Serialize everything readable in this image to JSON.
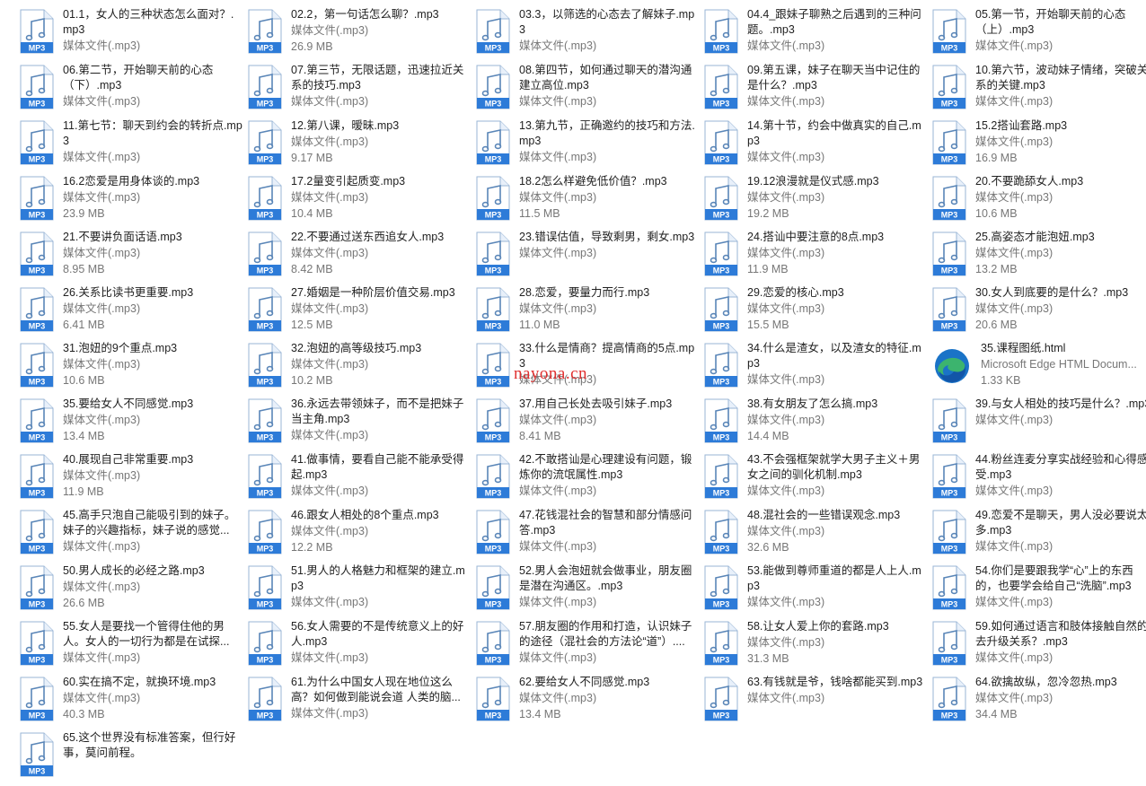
{
  "watermark": "nayona.cn",
  "icons": {
    "audio": "mp3-music-file-icon",
    "html": "microsoft-edge-icon"
  },
  "colors": {
    "mp3_badge": "#2d7bd8",
    "edge_blue": "#1a73c7",
    "edge_green": "#3cb46e"
  },
  "files": [
    {
      "name": "01.1，女人的三种状态怎么面对？.mp3",
      "type": "媒体文件(.mp3)",
      "size": "",
      "icon": "audio"
    },
    {
      "name": "02.2，第一句话怎么聊？.mp3",
      "type": "媒体文件(.mp3)",
      "size": "26.9 MB",
      "icon": "audio"
    },
    {
      "name": "03.3，以筛选的心态去了解妹子.mp3",
      "type": "媒体文件(.mp3)",
      "size": "",
      "icon": "audio"
    },
    {
      "name": "04.4_跟妹子聊熟之后遇到的三种问题。.mp3",
      "type": "媒体文件(.mp3)",
      "size": "",
      "icon": "audio"
    },
    {
      "name": "05.第一节，开始聊天前的心态（上）.mp3",
      "type": "媒体文件(.mp3)",
      "size": "",
      "icon": "audio"
    },
    {
      "name": "06.第二节，开始聊天前的心态（下）.mp3",
      "type": "媒体文件(.mp3)",
      "size": "",
      "icon": "audio"
    },
    {
      "name": "07.第三节，无限话题，迅速拉近关系的技巧.mp3",
      "type": "媒体文件(.mp3)",
      "size": "",
      "icon": "audio"
    },
    {
      "name": "08.第四节，如何通过聊天的潜沟通建立高位.mp3",
      "type": "媒体文件(.mp3)",
      "size": "",
      "icon": "audio"
    },
    {
      "name": "09.第五课，妹子在聊天当中记住的是什么？.mp3",
      "type": "媒体文件(.mp3)",
      "size": "",
      "icon": "audio"
    },
    {
      "name": "10.第六节，波动妹子情绪，突破关系的关键.mp3",
      "type": "媒体文件(.mp3)",
      "size": "",
      "icon": "audio"
    },
    {
      "name": "11.第七节：聊天到约会的转折点.mp3",
      "type": "媒体文件(.mp3)",
      "size": "",
      "icon": "audio"
    },
    {
      "name": "12.第八课，暧昧.mp3",
      "type": "媒体文件(.mp3)",
      "size": "9.17 MB",
      "icon": "audio"
    },
    {
      "name": "13.第九节，正确邀约的技巧和方法.mp3",
      "type": "媒体文件(.mp3)",
      "size": "",
      "icon": "audio"
    },
    {
      "name": "14.第十节，约会中做真实的自己.mp3",
      "type": "媒体文件(.mp3)",
      "size": "",
      "icon": "audio"
    },
    {
      "name": "15.2搭讪套路.mp3",
      "type": "媒体文件(.mp3)",
      "size": "16.9 MB",
      "icon": "audio"
    },
    {
      "name": "16.2恋爱是用身体谈的.mp3",
      "type": "媒体文件(.mp3)",
      "size": "23.9 MB",
      "icon": "audio"
    },
    {
      "name": "17.2量变引起质变.mp3",
      "type": "媒体文件(.mp3)",
      "size": "10.4 MB",
      "icon": "audio"
    },
    {
      "name": "18.2怎么样避免低价值？.mp3",
      "type": "媒体文件(.mp3)",
      "size": "11.5 MB",
      "icon": "audio"
    },
    {
      "name": "19.12浪漫就是仪式感.mp3",
      "type": "媒体文件(.mp3)",
      "size": "19.2 MB",
      "icon": "audio"
    },
    {
      "name": "20.不要跪舔女人.mp3",
      "type": "媒体文件(.mp3)",
      "size": "10.6 MB",
      "icon": "audio"
    },
    {
      "name": "21.不要讲负面话语.mp3",
      "type": "媒体文件(.mp3)",
      "size": "8.95 MB",
      "icon": "audio"
    },
    {
      "name": "22.不要通过送东西追女人.mp3",
      "type": "媒体文件(.mp3)",
      "size": "8.42 MB",
      "icon": "audio"
    },
    {
      "name": "23.错误估值，导致剩男，剩女.mp3",
      "type": "媒体文件(.mp3)",
      "size": "",
      "icon": "audio"
    },
    {
      "name": "24.搭讪中要注意的8点.mp3",
      "type": "媒体文件(.mp3)",
      "size": "11.9 MB",
      "icon": "audio"
    },
    {
      "name": "25.高姿态才能泡妞.mp3",
      "type": "媒体文件(.mp3)",
      "size": "13.2 MB",
      "icon": "audio"
    },
    {
      "name": "26.关系比读书更重要.mp3",
      "type": "媒体文件(.mp3)",
      "size": "6.41 MB",
      "icon": "audio"
    },
    {
      "name": "27.婚姻是一种阶层价值交易.mp3",
      "type": "媒体文件(.mp3)",
      "size": "12.5 MB",
      "icon": "audio"
    },
    {
      "name": "28.恋爱，要量力而行.mp3",
      "type": "媒体文件(.mp3)",
      "size": "11.0 MB",
      "icon": "audio"
    },
    {
      "name": "29.恋爱的核心.mp3",
      "type": "媒体文件(.mp3)",
      "size": "15.5 MB",
      "icon": "audio"
    },
    {
      "name": "30.女人到底要的是什么？.mp3",
      "type": "媒体文件(.mp3)",
      "size": "20.6 MB",
      "icon": "audio"
    },
    {
      "name": "31.泡妞的9个重点.mp3",
      "type": "媒体文件(.mp3)",
      "size": "10.6 MB",
      "icon": "audio"
    },
    {
      "name": "32.泡妞的高等级技巧.mp3",
      "type": "媒体文件(.mp3)",
      "size": "10.2 MB",
      "icon": "audio"
    },
    {
      "name": "33.什么是情商？提高情商的5点.mp3",
      "type": "媒体文件(.mp3)",
      "size": "",
      "icon": "audio"
    },
    {
      "name": "34.什么是渣女，以及渣女的特征.mp3",
      "type": "媒体文件(.mp3)",
      "size": "",
      "icon": "audio"
    },
    {
      "name": "35.课程图纸.html",
      "type": "Microsoft Edge HTML Docum...",
      "size": "1.33 KB",
      "icon": "html"
    },
    {
      "name": "35.要给女人不同感觉.mp3",
      "type": "媒体文件(.mp3)",
      "size": "13.4 MB",
      "icon": "audio"
    },
    {
      "name": "36.永远去带领妹子，而不是把妹子当主角.mp3",
      "type": "媒体文件(.mp3)",
      "size": "",
      "icon": "audio"
    },
    {
      "name": "37.用自己长处去吸引妹子.mp3",
      "type": "媒体文件(.mp3)",
      "size": "8.41 MB",
      "icon": "audio"
    },
    {
      "name": "38.有女朋友了怎么搞.mp3",
      "type": "媒体文件(.mp3)",
      "size": "14.4 MB",
      "icon": "audio"
    },
    {
      "name": "39.与女人相处的技巧是什么？.mp3",
      "type": "媒体文件(.mp3)",
      "size": "",
      "icon": "audio"
    },
    {
      "name": "40.展现自己非常重要.mp3",
      "type": "媒体文件(.mp3)",
      "size": "11.9 MB",
      "icon": "audio"
    },
    {
      "name": "41.做事情，要看自己能不能承受得起.mp3",
      "type": "媒体文件(.mp3)",
      "size": "",
      "icon": "audio"
    },
    {
      "name": "42.不敢搭讪是心理建设有问题，锻炼你的流氓属性.mp3",
      "type": "媒体文件(.mp3)",
      "size": "",
      "icon": "audio"
    },
    {
      "name": "43.不会强框架就学大男子主义＋男女之间的驯化机制.mp3",
      "type": "媒体文件(.mp3)",
      "size": "",
      "icon": "audio"
    },
    {
      "name": "44.粉丝连麦分享实战经验和心得感受.mp3",
      "type": "媒体文件(.mp3)",
      "size": "",
      "icon": "audio"
    },
    {
      "name": "45.高手只泡自己能吸引到的妹子。妹子的兴趣指标，妹子说的感觉...",
      "type": "媒体文件(.mp3)",
      "size": "",
      "icon": "audio"
    },
    {
      "name": "46.跟女人相处的8个重点.mp3",
      "type": "媒体文件(.mp3)",
      "size": "12.2 MB",
      "icon": "audio"
    },
    {
      "name": "47.花钱混社会的智慧和部分情感问答.mp3",
      "type": "媒体文件(.mp3)",
      "size": "",
      "icon": "audio"
    },
    {
      "name": "48.混社会的一些错误观念.mp3",
      "type": "媒体文件(.mp3)",
      "size": "32.6 MB",
      "icon": "audio"
    },
    {
      "name": "49.恋爱不是聊天，男人没必要说太多.mp3",
      "type": "媒体文件(.mp3)",
      "size": "",
      "icon": "audio"
    },
    {
      "name": "50.男人成长的必经之路.mp3",
      "type": "媒体文件(.mp3)",
      "size": "26.6 MB",
      "icon": "audio"
    },
    {
      "name": "51.男人的人格魅力和框架的建立.mp3",
      "type": "媒体文件(.mp3)",
      "size": "",
      "icon": "audio"
    },
    {
      "name": "52.男人会泡妞就会做事业，朋友圈是潜在沟通区。.mp3",
      "type": "媒体文件(.mp3)",
      "size": "",
      "icon": "audio"
    },
    {
      "name": "53.能做到尊师重道的都是人上人.mp3",
      "type": "媒体文件(.mp3)",
      "size": "",
      "icon": "audio"
    },
    {
      "name": "54.你们是要跟我学“心”上的东西的，也要学会给自己“洗脑”.mp3",
      "type": "媒体文件(.mp3)",
      "size": "",
      "icon": "audio"
    },
    {
      "name": "55.女人是要找一个管得住他的男人。女人的一切行为都是在试探...",
      "type": "媒体文件(.mp3)",
      "size": "",
      "icon": "audio"
    },
    {
      "name": "56.女人需要的不是传统意义上的好人.mp3",
      "type": "媒体文件(.mp3)",
      "size": "",
      "icon": "audio"
    },
    {
      "name": "57.朋友圈的作用和打造，认识妹子的途径（混社会的方法论“道”）....",
      "type": "媒体文件(.mp3)",
      "size": "",
      "icon": "audio"
    },
    {
      "name": "58.让女人爱上你的套路.mp3",
      "type": "媒体文件(.mp3)",
      "size": "31.3 MB",
      "icon": "audio"
    },
    {
      "name": "59.如何通过语言和肢体接触自然的去升级关系？.mp3",
      "type": "媒体文件(.mp3)",
      "size": "",
      "icon": "audio"
    },
    {
      "name": "60.实在搞不定，就换环境.mp3",
      "type": "媒体文件(.mp3)",
      "size": "40.3 MB",
      "icon": "audio"
    },
    {
      "name": "61.为什么中国女人现在地位这么高？如何做到能说会道 人类的脑...",
      "type": "媒体文件(.mp3)",
      "size": "",
      "icon": "audio"
    },
    {
      "name": "62.要给女人不同感觉.mp3",
      "type": "媒体文件(.mp3)",
      "size": "13.4 MB",
      "icon": "audio"
    },
    {
      "name": "63.有钱就是爷，钱啥都能买到.mp3",
      "type": "媒体文件(.mp3)",
      "size": "",
      "icon": "audio"
    },
    {
      "name": "64.欲擒故纵，忽冷忽热.mp3",
      "type": "媒体文件(.mp3)",
      "size": "34.4 MB",
      "icon": "audio"
    },
    {
      "name": "65.这个世界没有标准答案，但行好事，莫问前程。",
      "type": "",
      "size": "",
      "icon": "audio"
    }
  ]
}
